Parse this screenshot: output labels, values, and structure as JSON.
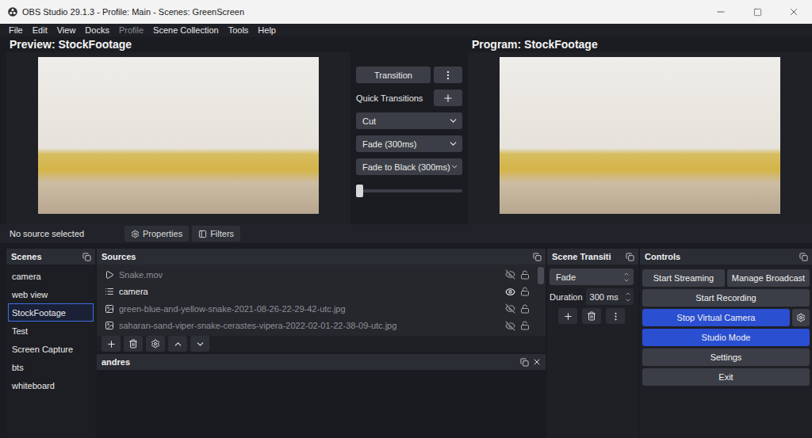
{
  "window": {
    "title": "OBS Studio 29.1.3 - Profile: Main - Scenes: GreenScreen"
  },
  "menu": [
    {
      "label": "File",
      "disabled": false
    },
    {
      "label": "Edit",
      "disabled": false
    },
    {
      "label": "View",
      "disabled": false
    },
    {
      "label": "Docks",
      "disabled": false
    },
    {
      "label": "Profile",
      "disabled": true
    },
    {
      "label": "Scene Collection",
      "disabled": false
    },
    {
      "label": "Tools",
      "disabled": false
    },
    {
      "label": "Help",
      "disabled": false
    }
  ],
  "preview": {
    "label": "Preview: StockFootage"
  },
  "program": {
    "label": "Program: StockFootage"
  },
  "transition_panel": {
    "transition_button": "Transition",
    "quick_label": "Quick Transitions",
    "quick_transitions": [
      "Cut",
      "Fade (300ms)",
      "Fade to Black (300ms)"
    ],
    "tbar_level": 0
  },
  "source_bar": {
    "status": "No source selected",
    "buttons": [
      "Properties",
      "Filters"
    ]
  },
  "scenes": {
    "title": "Scenes",
    "items": [
      {
        "label": "camera",
        "selected": false
      },
      {
        "label": "web view",
        "selected": false
      },
      {
        "label": "StockFootage",
        "selected": true
      },
      {
        "label": "Test",
        "selected": false
      },
      {
        "label": "Screen Capture",
        "selected": false
      },
      {
        "label": "bts",
        "selected": false
      },
      {
        "label": "whiteboard",
        "selected": false
      }
    ]
  },
  "sources": {
    "title": "Sources",
    "items": [
      {
        "name": "Snake.mov",
        "kind": "media",
        "visible": false,
        "locked": false
      },
      {
        "name": "camera",
        "kind": "group",
        "visible": true,
        "locked": false
      },
      {
        "name": "green-blue-and-yellow-snake-2021-08-26-22-29-42-utc.jpg",
        "kind": "image",
        "visible": false,
        "locked": false
      },
      {
        "name": "saharan-sand-viper-snake-cerastes-vipera-2022-02-01-22-38-09-utc.jpg",
        "kind": "image",
        "visible": false,
        "locked": false
      }
    ]
  },
  "custom_dock": {
    "title": "andres"
  },
  "scene_transitions": {
    "title": "Scene Transiti",
    "transition": "Fade",
    "duration_label": "Duration",
    "duration": "300 ms"
  },
  "controls": {
    "title": "Controls",
    "rows": [
      {
        "buttons": [
          {
            "label": "Start Streaming",
            "active": false
          },
          {
            "label": "Manage Broadcast",
            "active": false
          }
        ],
        "settings": false
      },
      {
        "buttons": [
          {
            "label": "Start Recording",
            "active": false
          }
        ],
        "settings": false
      },
      {
        "buttons": [
          {
            "label": "Stop Virtual Camera",
            "active": true
          }
        ],
        "settings": true
      },
      {
        "buttons": [
          {
            "label": "Studio Mode",
            "active": true
          }
        ],
        "settings": false
      },
      {
        "buttons": [
          {
            "label": "Settings",
            "active": false
          }
        ],
        "settings": false
      },
      {
        "buttons": [
          {
            "label": "Exit",
            "active": false
          }
        ],
        "settings": false
      }
    ]
  }
}
